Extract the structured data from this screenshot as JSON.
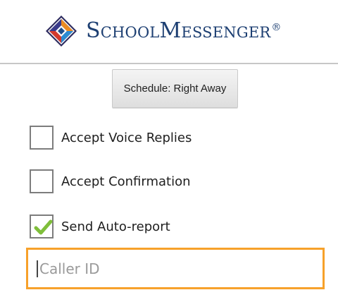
{
  "header": {
    "brand_name": "SchoolMessenger",
    "registered_mark": "®"
  },
  "schedule_button": {
    "label": "Schedule:  Right Away"
  },
  "options": [
    {
      "label": "Accept Voice Replies",
      "checked": false
    },
    {
      "label": "Accept Confirmation",
      "checked": false
    },
    {
      "label": "Send Auto-report",
      "checked": true
    }
  ],
  "caller_id": {
    "value": "",
    "placeholder": "Caller ID"
  },
  "colors": {
    "accent_focus": "#f7a12a",
    "brand_blue": "#1d3f72",
    "check_green": "#7fbe3a"
  },
  "icons": {
    "logo": "schoolmessenger-logo-icon",
    "check": "check-icon"
  }
}
